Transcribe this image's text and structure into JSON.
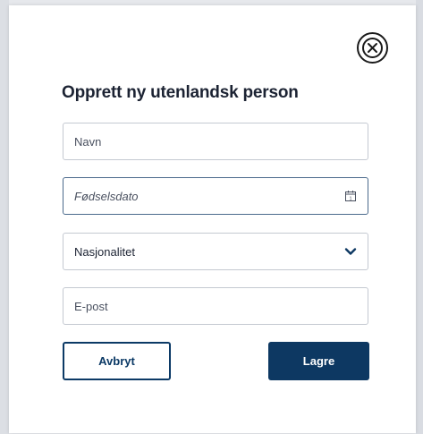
{
  "dialog": {
    "title": "Opprett ny utenlandsk person",
    "close_icon": "close-circle-icon"
  },
  "form": {
    "name_placeholder": "Navn",
    "dob_placeholder": "Fødselsdato",
    "dob_icon": "calendar-icon",
    "dob_icon_day": "1",
    "nationality_value": "Nasjonalitet",
    "nationality_icon": "chevron-down-icon",
    "email_placeholder": "E-post"
  },
  "actions": {
    "cancel_label": "Avbryt",
    "save_label": "Lagre"
  },
  "colors": {
    "primary": "#0d3862",
    "border": "#c4c9d1",
    "focused_border": "#4b6a8c",
    "title": "#1c2333"
  }
}
